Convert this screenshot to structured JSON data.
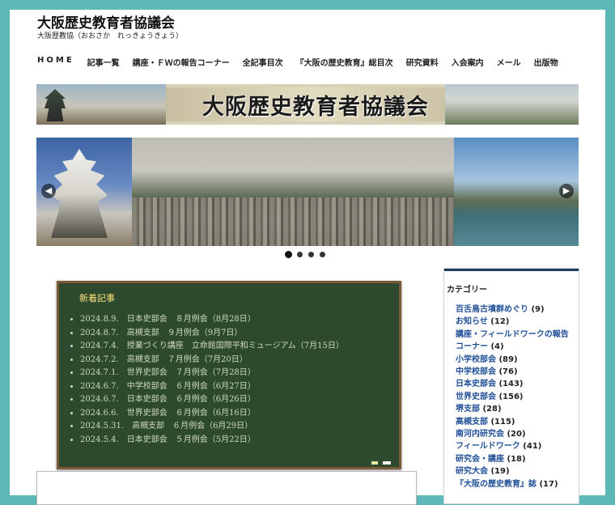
{
  "site": {
    "title": "大阪歴史教育者協議会",
    "subtitle": "大阪歴教協（おおさか　れっきょうきょう）"
  },
  "nav": {
    "items": [
      "HOME",
      "記事一覧",
      "講座・ＦＷの報告コーナー",
      "全記事目次",
      "『大阪の歴史教育』総目次",
      "研究資料",
      "入会案内",
      "メール",
      "出版物"
    ]
  },
  "banner": {
    "title": "大阪歴史教育者協議会"
  },
  "slider": {
    "prev": "◀",
    "next": "▶",
    "dot_count": 4,
    "active_dot": 1
  },
  "news": {
    "heading": "新着記事",
    "items": [
      "2024.8.9.　日本史部会　８月例会（8月28日）",
      "2024.8.7.　高槻支部　９月例会（9月7日）",
      "2024.7.4.　授業づくり講座　立命館国際平和ミュージアム（7月15日）",
      "2024.7.2.　高槻支部　７月例会（7月20日）",
      "2024.7.1.　世界史部会　７月例会（7月28日）",
      "2024.6.7.　中学校部会　６月例会（6月27日）",
      "2024.6.7.　日本史部会　６月例会（6月26日）",
      "2024.6.6.　世界史部会　６月例会（6月16日）",
      "2024.5.31.　高槻支部　６月例会（6月29日）",
      "2024.5.4.　日本史部会　５月例会（5月22日）"
    ]
  },
  "sidebar": {
    "title": "カテゴリー",
    "categories": [
      {
        "name": "百舌鳥古墳群めぐり",
        "count": "(9)"
      },
      {
        "name": "お知らせ",
        "count": "(12)"
      },
      {
        "name": "講座・フィールドワークの報告コーナー",
        "count": "(4)"
      },
      {
        "name": "小学校部会",
        "count": "(89)"
      },
      {
        "name": "中学校部会",
        "count": "(76)"
      },
      {
        "name": "日本史部会",
        "count": "(143)"
      },
      {
        "name": "世界史部会",
        "count": "(156)"
      },
      {
        "name": "堺支部",
        "count": "(28)"
      },
      {
        "name": "高槻支部",
        "count": "(115)"
      },
      {
        "name": "南河内研究会",
        "count": "(20)"
      },
      {
        "name": "フィールドワーク",
        "count": "(41)"
      },
      {
        "name": "研究会・講座",
        "count": "(18)"
      },
      {
        "name": "研究大会",
        "count": "(19)"
      },
      {
        "name": "『大阪の歴史教育』誌",
        "count": "(17)"
      }
    ]
  }
}
